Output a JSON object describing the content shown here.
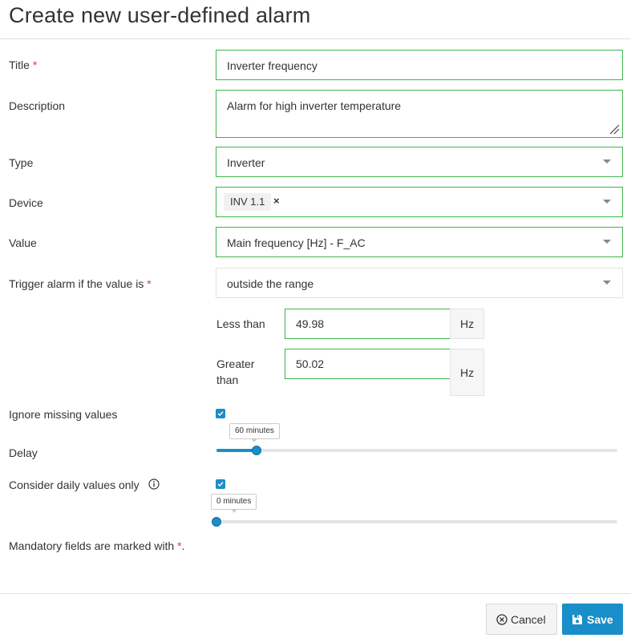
{
  "header": {
    "title": "Create new user-defined alarm"
  },
  "form": {
    "title": {
      "label": "Title",
      "required_mark": "*",
      "value": "Inverter frequency"
    },
    "description": {
      "label": "Description",
      "value": "Alarm for high inverter temperature"
    },
    "type": {
      "label": "Type",
      "value": "Inverter"
    },
    "device": {
      "label": "Device",
      "tag": "INV 1.1",
      "remove_tag": "×"
    },
    "value": {
      "label": "Value",
      "value": "Main frequency [Hz] - F_AC"
    },
    "trigger": {
      "label": "Trigger alarm if the value is",
      "required_mark": "*",
      "value": "outside the range"
    },
    "less_than": {
      "label": "Less than",
      "value": "49.98",
      "unit": "Hz"
    },
    "greater_than": {
      "label_line1": "Greater",
      "label_line2": "than",
      "value": "50.02",
      "unit": "Hz"
    },
    "ignore_missing": {
      "label": "Ignore missing values",
      "checked": true
    },
    "delay": {
      "label": "Delay",
      "tooltip": "60 minutes",
      "level_fraction": 0.1
    },
    "daily": {
      "label": "Consider daily values only",
      "checked": true,
      "tooltip": "0 minutes",
      "level_fraction": 0.0
    },
    "mandatory_note": {
      "text": "Mandatory fields are marked with",
      "mark": "*",
      "end": "."
    }
  },
  "footer": {
    "cancel_label": "Cancel",
    "save_label": "Save"
  },
  "icons": {
    "info": "info-icon",
    "cancel": "close-circle-icon",
    "save": "floppy-disk-icon",
    "dropdown": "chevron-down-icon",
    "check": "check-icon"
  },
  "colors": {
    "accent": "#1a8ec9",
    "valid_border": "#3db54a",
    "required": "#e53935"
  }
}
